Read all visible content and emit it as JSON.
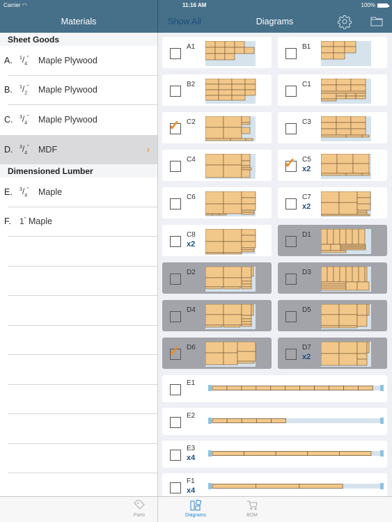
{
  "status_bar": {
    "carrier": "Carrier",
    "time": "11:16 AM",
    "battery": "100%"
  },
  "left_header": {
    "title": "Materials"
  },
  "right_header": {
    "show_all": "Show All",
    "title": "Diagrams",
    "gear_icon": "gear-icon",
    "folder_icon": "folder-icon"
  },
  "materials": {
    "sections": [
      {
        "title": "Sheet Goods",
        "items": [
          {
            "letter": "A.",
            "fraction_num": "1",
            "fraction_den": "4",
            "name": "Maple Plywood",
            "selected": false
          },
          {
            "letter": "B.",
            "fraction_num": "1",
            "fraction_den": "2",
            "name": "Maple Plywood",
            "selected": false
          },
          {
            "letter": "C.",
            "fraction_num": "3",
            "fraction_den": "4",
            "name": "Maple Plywood",
            "selected": false
          },
          {
            "letter": "D.",
            "fraction_num": "3",
            "fraction_den": "4",
            "name": "MDF",
            "selected": true
          }
        ]
      },
      {
        "title": "Dimensioned Lumber",
        "items": [
          {
            "letter": "E.",
            "fraction_num": "3",
            "fraction_den": "4",
            "name": "Maple",
            "selected": false
          },
          {
            "letter": "F.",
            "whole": "1",
            "name": "Maple",
            "selected": false
          }
        ]
      }
    ]
  },
  "diagrams": [
    {
      "label": "A1",
      "multiplier": "",
      "checked": false,
      "dimmed": false
    },
    {
      "label": "B1",
      "multiplier": "",
      "checked": false,
      "dimmed": false
    },
    {
      "label": "B2",
      "multiplier": "",
      "checked": false,
      "dimmed": false
    },
    {
      "label": "C1",
      "multiplier": "",
      "checked": false,
      "dimmed": false
    },
    {
      "label": "C2",
      "multiplier": "",
      "checked": true,
      "dimmed": false
    },
    {
      "label": "C3",
      "multiplier": "",
      "checked": false,
      "dimmed": false
    },
    {
      "label": "C4",
      "multiplier": "",
      "checked": false,
      "dimmed": false
    },
    {
      "label": "C5",
      "multiplier": "x2",
      "checked": true,
      "dimmed": false
    },
    {
      "label": "C6",
      "multiplier": "",
      "checked": false,
      "dimmed": false
    },
    {
      "label": "C7",
      "multiplier": "x2",
      "checked": false,
      "dimmed": false
    },
    {
      "label": "C8",
      "multiplier": "x2",
      "checked": false,
      "dimmed": false
    },
    {
      "label": "D1",
      "multiplier": "",
      "checked": false,
      "dimmed": true
    },
    {
      "label": "D2",
      "multiplier": "",
      "checked": false,
      "dimmed": true
    },
    {
      "label": "D3",
      "multiplier": "",
      "checked": false,
      "dimmed": true
    },
    {
      "label": "D4",
      "multiplier": "",
      "checked": false,
      "dimmed": true
    },
    {
      "label": "D5",
      "multiplier": "",
      "checked": false,
      "dimmed": true
    },
    {
      "label": "D6",
      "multiplier": "",
      "checked": true,
      "dimmed": true
    },
    {
      "label": "D7",
      "multiplier": "x2",
      "checked": false,
      "dimmed": true
    }
  ],
  "lumber_diagrams": [
    {
      "label": "E1",
      "multiplier": "",
      "checked": false,
      "pieces": 11,
      "used_fraction": 0.96
    },
    {
      "label": "E2",
      "multiplier": "",
      "checked": false,
      "pieces": 5,
      "used_fraction": 0.44
    },
    {
      "label": "E3",
      "multiplier": "x4",
      "checked": false,
      "pieces": 5,
      "used_fraction": 0.95
    },
    {
      "label": "F1",
      "multiplier": "x4",
      "checked": false,
      "pieces": 3,
      "used_fraction": 0.78
    }
  ],
  "check_glyph": "✓",
  "tabs": [
    {
      "label": "Parts",
      "icon": "tag-icon",
      "active": false
    },
    {
      "label": "Diagrams",
      "icon": "diagrams-icon",
      "active": true
    },
    {
      "label": "BOM",
      "icon": "cart-icon",
      "active": false
    }
  ],
  "colors": {
    "header": "#466f89",
    "accent_orange": "#f08c1e",
    "multiplier_blue": "#1d4f85",
    "part_fill": "#f2c78a",
    "sheet_bg": "#d6e3ec",
    "tab_active": "#2b85d0"
  }
}
